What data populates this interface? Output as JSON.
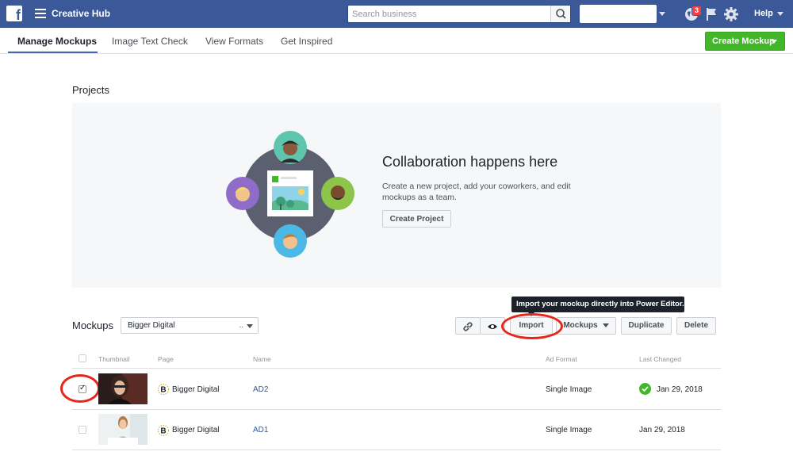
{
  "header": {
    "app_title": "Creative Hub",
    "search_placeholder": "Search business",
    "notifications_count": "3",
    "help_label": "Help"
  },
  "tabs": [
    {
      "label": "Manage Mockups",
      "active": true
    },
    {
      "label": "Image Text Check",
      "active": false
    },
    {
      "label": "View Formats",
      "active": false
    },
    {
      "label": "Get Inspired",
      "active": false
    }
  ],
  "create_mockup_label": "Create Mockup",
  "projects": {
    "title": "Projects",
    "heading": "Collaboration happens here",
    "description": "Create a new project, add your coworkers, and edit mockups as a team.",
    "create_project_label": "Create Project"
  },
  "mockups": {
    "title": "Mockups",
    "page_filter": "Bigger Digital",
    "page_filter_suffix": "..",
    "tooltip": "Import your mockup directly into Power Editor.",
    "buttons": {
      "import": "Import",
      "mockups": "Mockups",
      "duplicate": "Duplicate",
      "delete": "Delete"
    },
    "columns": [
      "Thumbnail",
      "Page",
      "Name",
      "Ad Format",
      "Last Changed"
    ],
    "rows": [
      {
        "checked": true,
        "page": "Bigger Digital",
        "name": "AD2",
        "ad_format": "Single Image",
        "last_changed": "Jan 29, 2018",
        "status": "ok"
      },
      {
        "checked": false,
        "page": "Bigger Digital",
        "name": "AD1",
        "ad_format": "Single Image",
        "last_changed": "Jan 29, 2018",
        "status": ""
      }
    ]
  },
  "colors": {
    "brand": "#3b5998",
    "accent_green": "#42b72a",
    "highlight_red": "#e8251b",
    "panel_bg": "#f6f7f9"
  },
  "icons": {
    "facebook": "facebook-logo-icon",
    "menu": "hamburger-menu-icon",
    "search": "search-icon",
    "globe": "globe-icon",
    "flag": "flag-icon",
    "settings": "gear-icon",
    "link": "link-icon",
    "preview": "eye-icon",
    "status": "check-circle-icon",
    "page_avatar": "bigger-digital-logo-icon"
  }
}
